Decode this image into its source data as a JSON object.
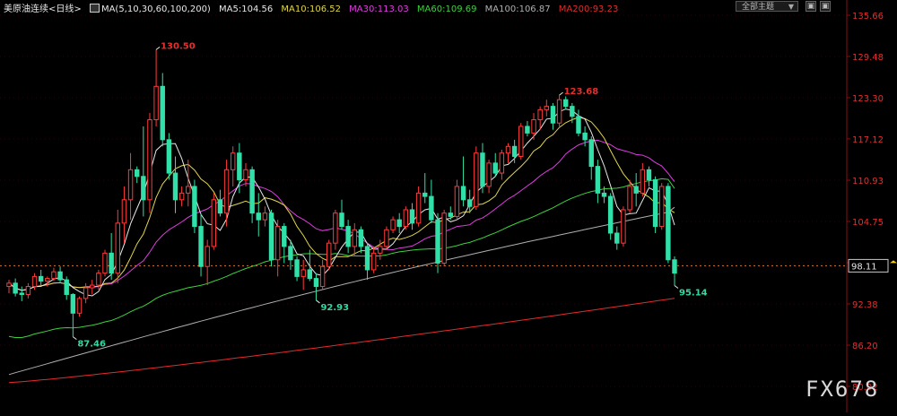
{
  "header": {
    "symbol": "美原油连续",
    "period": "<日线>",
    "ma_params": "MA(5,10,30,60,100,200)",
    "ma5": "MA5:104.56",
    "ma10": "MA10:106.52",
    "ma30": "MA30:113.03",
    "ma60": "MA60:109.69",
    "ma100": "MA100:106.87",
    "ma200": "MA200:93.23"
  },
  "toolbar": {
    "theme_label": "全部主题",
    "theme_caret": "▼",
    "btn1": "▣",
    "btn2": "▣"
  },
  "watermark": "FX678",
  "colors": {
    "up": "#ff3b3b",
    "down": "#30e0a8",
    "ma5": "#e8e8e8",
    "ma10": "#e0d64a",
    "ma30": "#e03ce0",
    "ma60": "#3cd23c",
    "ma100": "#b0b0b0",
    "ma200": "#e62a2a",
    "grid": "#8a1010",
    "text_red": "#e03030",
    "text_green": "#36d7a0",
    "ref_line": "#d97a2a",
    "price_tag": "#ffd200"
  },
  "chart_data": {
    "type": "candlestick",
    "ylim": [
      80.02,
      135.66
    ],
    "yticks": [
      "135.66",
      "129.48",
      "123.30",
      "117.12",
      "110.93",
      "104.75",
      "98.57",
      "92.38",
      "86.20",
      "80.02"
    ],
    "current_price": "98.11",
    "annotations": [
      {
        "label": "130.50",
        "kind": "high"
      },
      {
        "label": "87.46",
        "kind": "low"
      },
      {
        "label": "92.93",
        "kind": "low"
      },
      {
        "label": "123.68",
        "kind": "high"
      },
      {
        "label": "95.14",
        "kind": "low"
      }
    ],
    "candles": [
      [
        95,
        96,
        94,
        95.5
      ],
      [
        95.5,
        96.2,
        93.5,
        94
      ],
      [
        94,
        95,
        92.8,
        93.8
      ],
      [
        93.8,
        95.5,
        93.2,
        95
      ],
      [
        95,
        97,
        94.5,
        96.5
      ],
      [
        96.5,
        97.5,
        95.2,
        95.8
      ],
      [
        95.8,
        96.5,
        95,
        96.2
      ],
      [
        96.2,
        97.8,
        95.8,
        97.2
      ],
      [
        97.2,
        98,
        95.5,
        96
      ],
      [
        96,
        96.5,
        93,
        93.8
      ],
      [
        93.8,
        94,
        87.46,
        91
      ],
      [
        91,
        93.5,
        90.5,
        93.2
      ],
      [
        93.2,
        95.5,
        92.5,
        94.8
      ],
      [
        94.8,
        96,
        93.8,
        95.2
      ],
      [
        95.2,
        97.5,
        94.5,
        97
      ],
      [
        97,
        100.5,
        96.5,
        100
      ],
      [
        100,
        103,
        96,
        97
      ],
      [
        97,
        106.5,
        95.5,
        104.5
      ],
      [
        104.5,
        110,
        101.5,
        108
      ],
      [
        108,
        115,
        105,
        112.5
      ],
      [
        112.5,
        113,
        110.5,
        111.5
      ],
      [
        111.5,
        119,
        105.5,
        108
      ],
      [
        108,
        121,
        106,
        120
      ],
      [
        120,
        130.5,
        119,
        125
      ],
      [
        125,
        127,
        116,
        117
      ],
      [
        117,
        118,
        111,
        112
      ],
      [
        112,
        114.5,
        106,
        108
      ],
      [
        108,
        110,
        107,
        109
      ],
      [
        109,
        114,
        107,
        110
      ],
      [
        110,
        111,
        103,
        104
      ],
      [
        104,
        106,
        96.5,
        98
      ],
      [
        98,
        102,
        95.2,
        101
      ],
      [
        101,
        109,
        100.5,
        108
      ],
      [
        108,
        109.5,
        105.5,
        106
      ],
      [
        106,
        114,
        104,
        112.5
      ],
      [
        112.5,
        116,
        110,
        115
      ],
      [
        115,
        116.5,
        109,
        111
      ],
      [
        111,
        113.5,
        110,
        112.5
      ],
      [
        112.5,
        113,
        104.5,
        106
      ],
      [
        106,
        109,
        102.5,
        105
      ],
      [
        105,
        107,
        104,
        106
      ],
      [
        106,
        106.5,
        98,
        99
      ],
      [
        99,
        105,
        96.5,
        104
      ],
      [
        104,
        104.5,
        98.5,
        101
      ],
      [
        101,
        102,
        97.5,
        99
      ],
      [
        99,
        99.5,
        95.8,
        96.5
      ],
      [
        96.5,
        99,
        94.5,
        97.5
      ],
      [
        97.5,
        100.5,
        95.8,
        96.2
      ],
      [
        96.2,
        97,
        92.93,
        95
      ],
      [
        95,
        99,
        94.5,
        98
      ],
      [
        98,
        102,
        97.5,
        101.5
      ],
      [
        101.5,
        106.5,
        100.5,
        106
      ],
      [
        106,
        108,
        103.5,
        104
      ],
      [
        104,
        105,
        100,
        101
      ],
      [
        101,
        104.5,
        99.5,
        103.5
      ],
      [
        103.5,
        104,
        100,
        101
      ],
      [
        101,
        101.5,
        96,
        97.5
      ],
      [
        97.5,
        101,
        97,
        100
      ],
      [
        100,
        102,
        99,
        101
      ],
      [
        101,
        104,
        100.5,
        103.5
      ],
      [
        103.5,
        105.5,
        103,
        105
      ],
      [
        105,
        106,
        103,
        104
      ],
      [
        104,
        107,
        103.5,
        106.5
      ],
      [
        106.5,
        107.5,
        103.5,
        104.5
      ],
      [
        104.5,
        110,
        104,
        109
      ],
      [
        109,
        112,
        107.5,
        108.5
      ],
      [
        108.5,
        111,
        104.5,
        105
      ],
      [
        105,
        106,
        97,
        98.5
      ],
      [
        98.5,
        106.5,
        98,
        106
      ],
      [
        106,
        107,
        105,
        105.5
      ],
      [
        105.5,
        111,
        105,
        110
      ],
      [
        110,
        114.5,
        107,
        108
      ],
      [
        108,
        109.5,
        106,
        107
      ],
      [
        107,
        116,
        106.5,
        115
      ],
      [
        115,
        116.5,
        109,
        110
      ],
      [
        110,
        114,
        109,
        113.5
      ],
      [
        113.5,
        115,
        111.5,
        112
      ],
      [
        112,
        115.5,
        111,
        115
      ],
      [
        115,
        116.5,
        113.5,
        116
      ],
      [
        116,
        117,
        113.5,
        114.5
      ],
      [
        114.5,
        119.5,
        114,
        119
      ],
      [
        119,
        119.8,
        117.5,
        118
      ],
      [
        118,
        121,
        117,
        120
      ],
      [
        120,
        122,
        118.5,
        121.5
      ],
      [
        121.5,
        123,
        120.5,
        122
      ],
      [
        122,
        122.5,
        118.5,
        119.5
      ],
      [
        119.5,
        123.68,
        119,
        123
      ],
      [
        123,
        123.5,
        121.5,
        122
      ],
      [
        122,
        122.5,
        119.5,
        120.5
      ],
      [
        120.5,
        121.5,
        117.5,
        118
      ],
      [
        118,
        119,
        116,
        117
      ],
      [
        117,
        117.5,
        111,
        113
      ],
      [
        113,
        114,
        107.5,
        109
      ],
      [
        109,
        110,
        107.5,
        108.5
      ],
      [
        108.5,
        109,
        102,
        103
      ],
      [
        103,
        104,
        100.5,
        101.5
      ],
      [
        101.5,
        107,
        101,
        106.5
      ],
      [
        106.5,
        111,
        106,
        110
      ],
      [
        110,
        112,
        107,
        109
      ],
      [
        109,
        113.5,
        108.5,
        112.5
      ],
      [
        112.5,
        113,
        110,
        111
      ],
      [
        111,
        111.5,
        103,
        104
      ],
      [
        104,
        110.5,
        103.5,
        110
      ],
      [
        110,
        110.5,
        98.5,
        99
      ],
      [
        99,
        99.5,
        95.14,
        97
      ]
    ]
  }
}
